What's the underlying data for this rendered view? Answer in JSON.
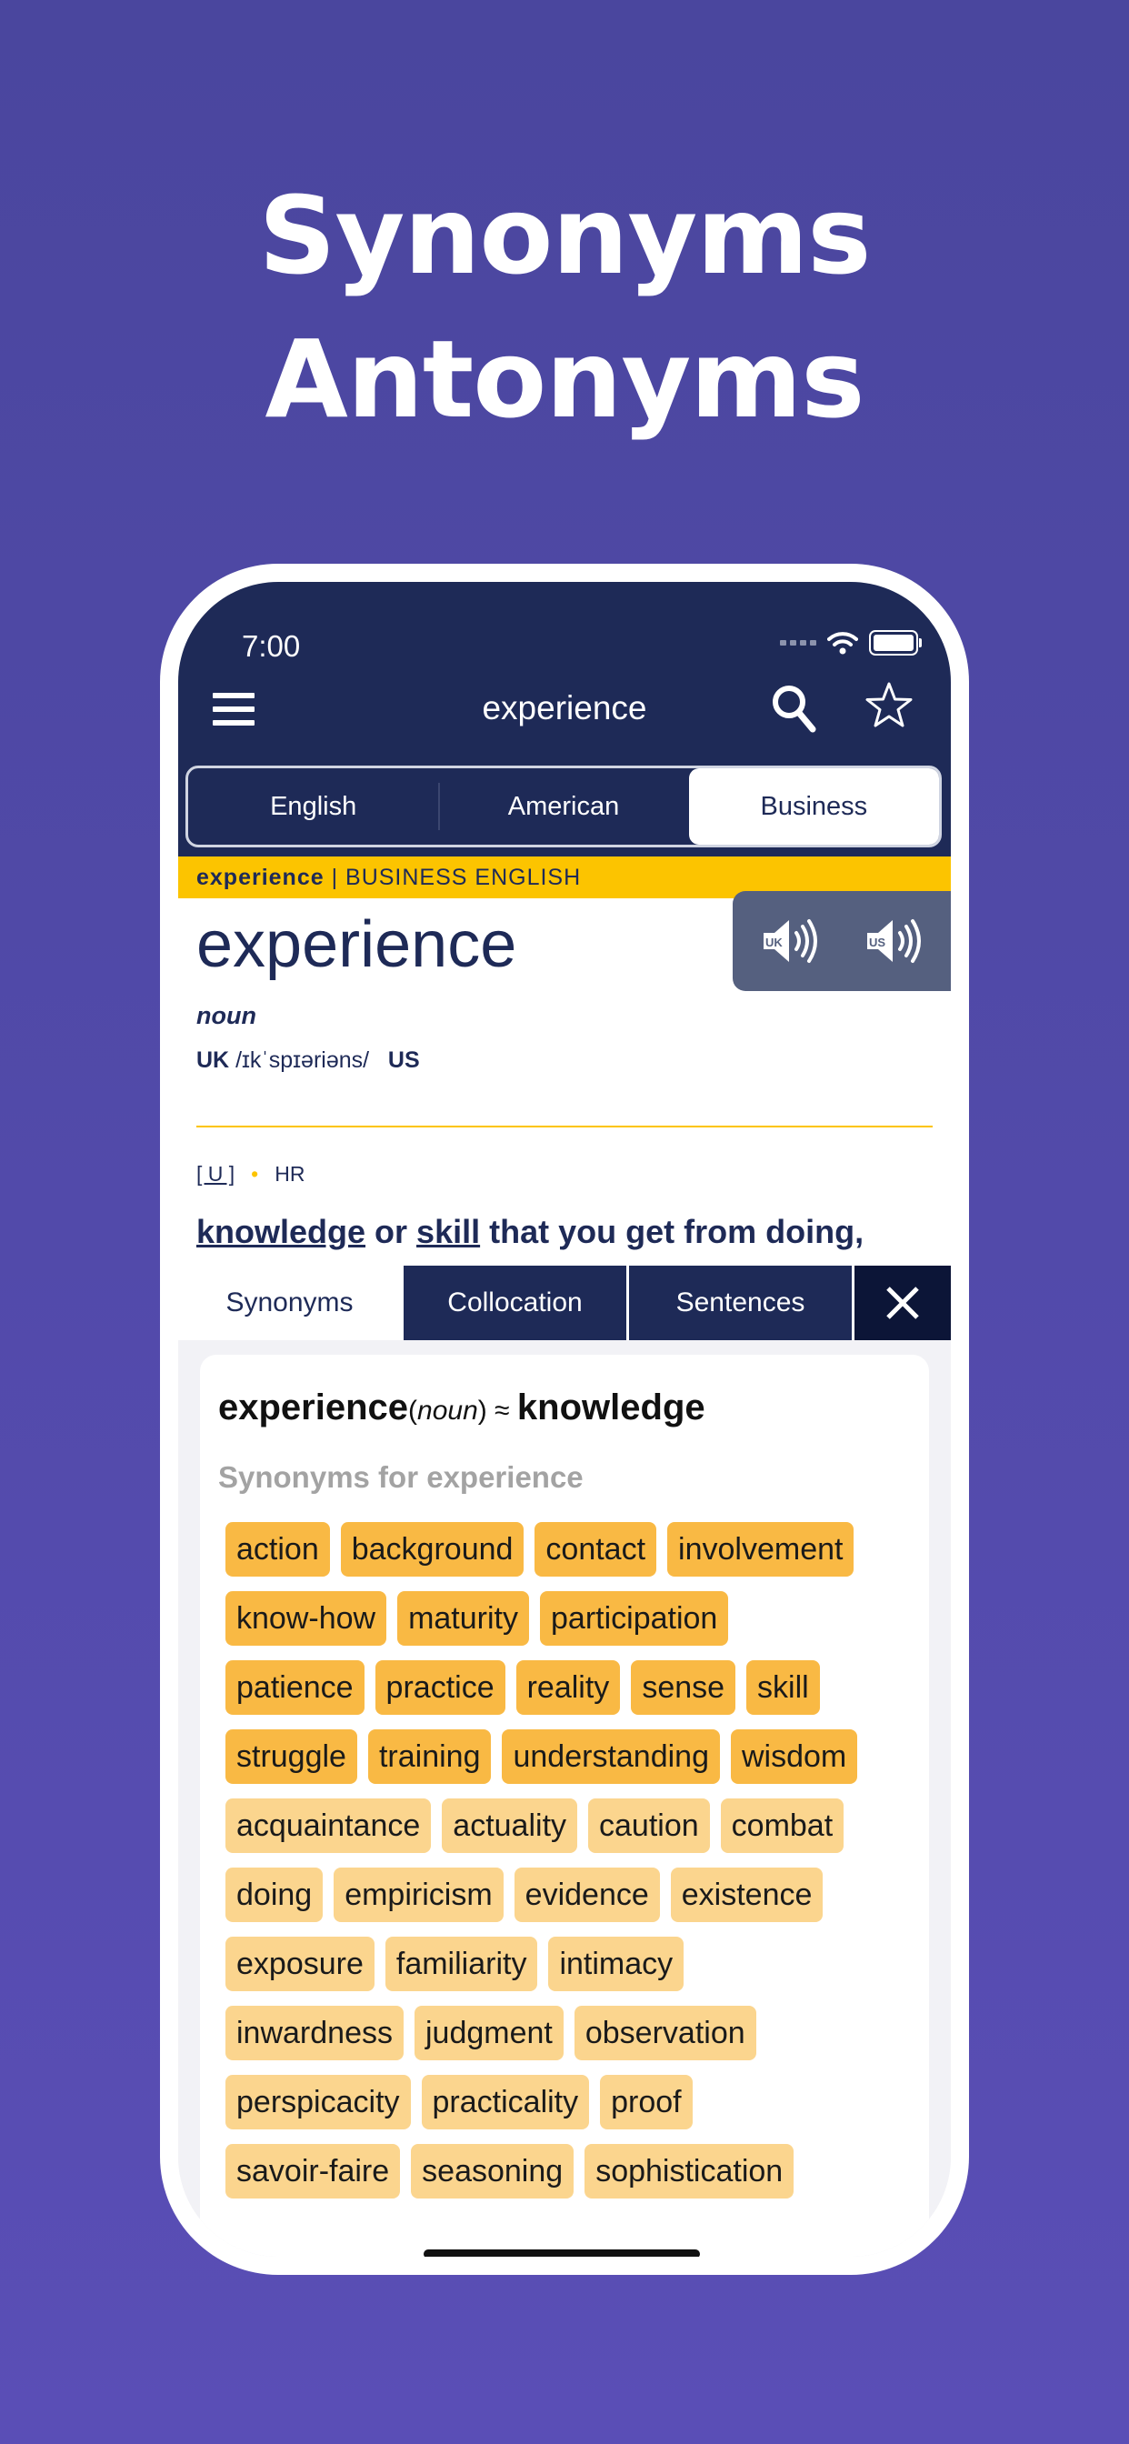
{
  "headline": {
    "line1": "Synonyms",
    "line2": "Antonyms"
  },
  "status_bar": {
    "time": "7:00"
  },
  "nav": {
    "title": "experience",
    "icons": [
      "menu-icon",
      "search-icon",
      "star-icon"
    ]
  },
  "dictionary_tabs": [
    {
      "label": "English",
      "active": false
    },
    {
      "label": "American",
      "active": false
    },
    {
      "label": "Business",
      "active": true
    }
  ],
  "entry": {
    "banner_word": "experience",
    "banner_section": " | BUSINESS ENGLISH",
    "headword": "experience",
    "part_of_speech": "noun",
    "pron_uk_label": "UK",
    "pron_uk": "/ɪkˈspɪəriəns/",
    "pron_us_label": "US",
    "grammar": "[ U ]",
    "grammar_dot": "•",
    "label": "HR",
    "definition": {
      "word1": "knowledge",
      "connector": " or ",
      "word2": "skill",
      "rest": " that you get from doing,"
    }
  },
  "audio_buttons": [
    {
      "label": "UK",
      "icon": "speaker-uk-icon"
    },
    {
      "label": "US",
      "icon": "speaker-us-icon"
    }
  ],
  "bottom_tabs": [
    {
      "label": "Synonyms",
      "active": true
    },
    {
      "label": "Collocation",
      "active": false
    },
    {
      "label": "Sentences",
      "active": false
    }
  ],
  "synonyms": {
    "head_word": "experience",
    "head_pos": "noun",
    "approx": " ≈ ",
    "head_target": "knowledge",
    "subtitle": "Synonyms for experience",
    "rows": [
      [
        "action",
        "background",
        "contact",
        "involvement"
      ],
      [
        "know-how",
        "maturity",
        "participation"
      ],
      [
        "patience",
        "practice",
        "reality",
        "sense",
        "skill"
      ],
      [
        "struggle",
        "training",
        "understanding",
        "wisdom"
      ],
      [
        "acquaintance",
        "actuality",
        "caution",
        "combat"
      ],
      [
        "doing",
        "empiricism",
        "evidence",
        "existence"
      ],
      [
        "exposure",
        "familiarity",
        "intimacy"
      ],
      [
        "inwardness",
        "judgment",
        "observation"
      ],
      [
        "perspicacity",
        "practicality",
        "proof"
      ],
      [
        "savoir-faire",
        "seasoning",
        "sophistication"
      ]
    ],
    "strong_row_count": 4
  },
  "colors": {
    "navy": "#1e2a57",
    "accent_yellow": "#fcc400",
    "chip_strong": "#f9b944",
    "chip_light": "#fbd58e",
    "background": "#4a469e"
  }
}
